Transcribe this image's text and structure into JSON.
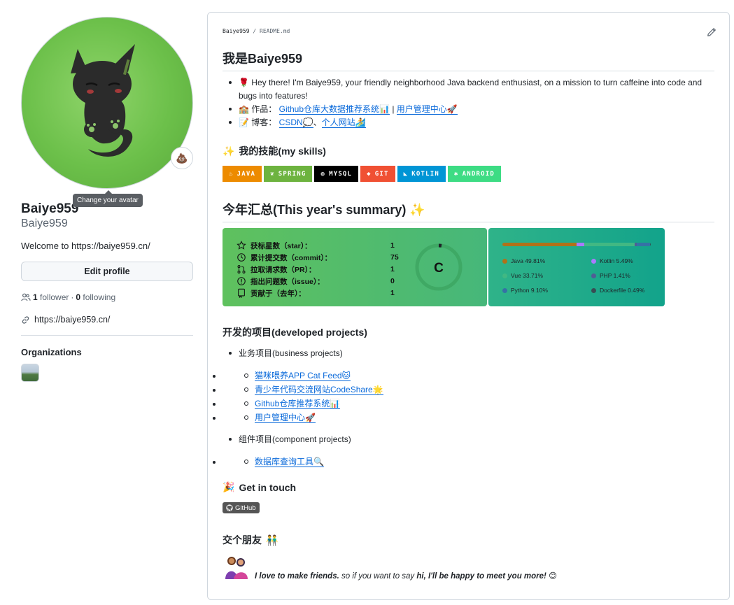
{
  "sidebar": {
    "tooltip": "Change your avatar",
    "status_emoji": "💩",
    "name": "Baiye959",
    "login": "Baiye959",
    "bio": "Welcome to https://baiye959.cn/",
    "edit_profile": "Edit profile",
    "followers_count": "1",
    "followers_label": "follower",
    "separator": "·",
    "following_count": "0",
    "following_label": "following",
    "website": "https://baiye959.cn/",
    "organizations_title": "Organizations"
  },
  "readme": {
    "path_user": "Baiye959",
    "path_sep": "/",
    "path_file": "README.md",
    "title": "我是Baiye959",
    "intro": {
      "emoji": "🌹",
      "text": "Hey there! I'm Baiye959, your friendly neighborhood Java backend enthusiast, on a mission to turn caffeine into code and bugs into features!"
    },
    "works": {
      "emoji": "🏫",
      "label": "作品：",
      "link1": "Github仓库大数据推荐系统📊",
      "sep": "|",
      "link2": "用户管理中心🚀"
    },
    "blog": {
      "emoji": "📝",
      "label": "博客：",
      "link1": "CSDN💭",
      "sep": "、",
      "link2": "个人网站🏄"
    },
    "skills_title": "我的技能(my skills)",
    "skills_emoji": "✨",
    "badges": [
      {
        "label": "JAVA",
        "color": "#ED8B00",
        "icon": "java-icon"
      },
      {
        "label": "SPRING",
        "color": "#6DB33F",
        "icon": "spring-icon"
      },
      {
        "label": "MYSQL",
        "color": "#005C84",
        "icon": "mysql-icon"
      },
      {
        "label": "GIT",
        "color": "#F05033",
        "icon": "git-icon"
      },
      {
        "label": "KOTLIN",
        "color": "#0095D5",
        "icon": "kotlin-icon"
      },
      {
        "label": "ANDROID",
        "color": "#3DDC84",
        "icon": "android-icon"
      }
    ],
    "summary_title": "今年汇总(This year's summary)",
    "summary_emoji": "✨",
    "stats": [
      {
        "label": "获标星数（star）：",
        "value": "1",
        "icon": "star-icon"
      },
      {
        "label": "累计提交数（commit）：",
        "value": "75",
        "icon": "history-icon"
      },
      {
        "label": "拉取请求数（PR）：",
        "value": "1",
        "icon": "pull-request-icon"
      },
      {
        "label": "指出问题数（issue）：",
        "value": "0",
        "icon": "issue-icon"
      },
      {
        "label": "贡献于（去年）：",
        "value": "1",
        "icon": "repo-icon"
      }
    ],
    "grade": "C",
    "languages": [
      {
        "name": "Java",
        "percent": "49.81%",
        "value": 49.81,
        "color": "#b07219"
      },
      {
        "name": "Kotlin",
        "percent": "5.49%",
        "value": 5.49,
        "color": "#A97BFF"
      },
      {
        "name": "Vue",
        "percent": "33.71%",
        "value": 33.71,
        "color": "#41b883"
      },
      {
        "name": "PHP",
        "percent": "1.41%",
        "value": 1.41,
        "color": "#4F5D95"
      },
      {
        "name": "Python",
        "percent": "9.10%",
        "value": 9.1,
        "color": "#3572A5"
      },
      {
        "name": "Dockerfile",
        "percent": "0.49%",
        "value": 0.49,
        "color": "#384d54"
      }
    ],
    "projects_title": "开发的项目(developed projects)",
    "business_label": "业务项目(business projects)",
    "business_projects": [
      "猫咪喂养APP Cat Feed🐱",
      "青少年代码交流网站CodeShare🌟",
      "Github仓库推荐系统📊",
      "用户管理中心🚀"
    ],
    "component_label": "组件项目(component projects)",
    "component_projects": [
      "数据库查询工具🔍"
    ],
    "contact_title": "Get in touch",
    "contact_emoji": "🎉",
    "github_badge": "GitHub",
    "friends_title": "交个朋友",
    "friends_emoji": "👬",
    "footer": {
      "part1": "I love to make friends.",
      "part2": " so if you want to say ",
      "part3": "hi, I'll be happy to meet you more!",
      "emoji": "😊"
    }
  },
  "colors": {
    "link": "#0969da",
    "border": "#d0d7de",
    "text": "#1f2328",
    "muted": "#59636e"
  }
}
